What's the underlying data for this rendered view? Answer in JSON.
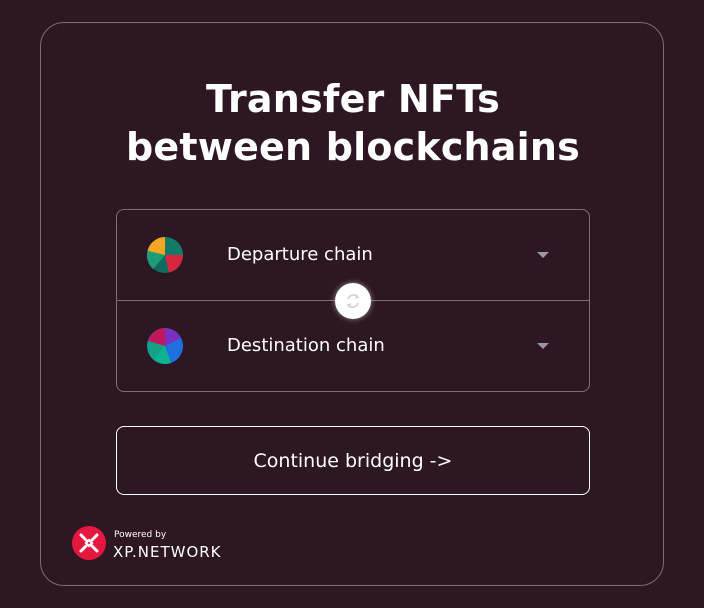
{
  "title": {
    "line1": "Transfer NFTs",
    "line2": "between blockchains"
  },
  "departure": {
    "label": "Departure chain",
    "icon": "chain-placeholder-icon"
  },
  "destination": {
    "label": "Destination chain",
    "icon": "chain-placeholder-icon"
  },
  "swap": {
    "icon": "swap-icon"
  },
  "continue_label": "Continue bridging ->",
  "footer": {
    "powered_by": "Powered by",
    "brand": "XP.NETWORK",
    "logo_icon": "xp-network-logo"
  },
  "colors": {
    "background": "#2c1722",
    "border": "#7e6f77",
    "text": "#ffffff",
    "caret": "#9a95a8",
    "brand_red": "#e6173f"
  }
}
